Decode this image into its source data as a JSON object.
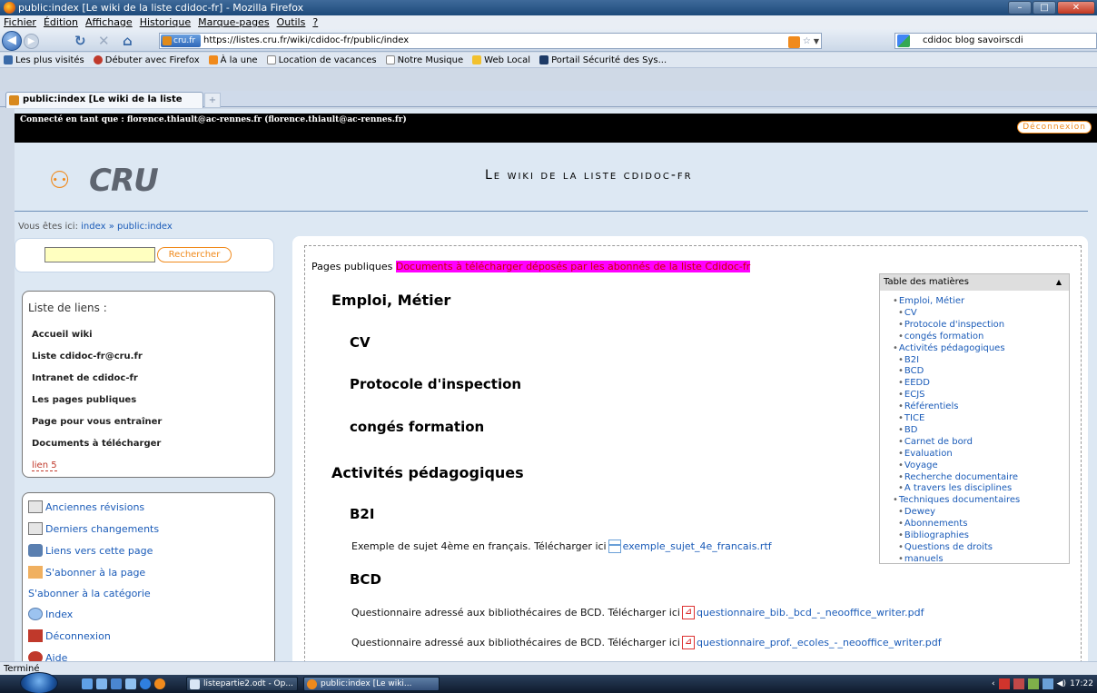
{
  "window": {
    "title": "public:index [Le wiki de la liste cdidoc-fr] - Mozilla Firefox"
  },
  "menu": [
    "Fichier",
    "Édition",
    "Affichage",
    "Historique",
    "Marque-pages",
    "Outils",
    "?"
  ],
  "nav": {
    "url": "https://listes.cru.fr/wiki/cdidoc-fr/public/index",
    "site_badge": "cru.fr",
    "search_value": "cdidoc blog savoirscdi"
  },
  "bookmarks": [
    {
      "label": "Les plus visités"
    },
    {
      "label": "Débuter avec Firefox"
    },
    {
      "label": "À la une"
    },
    {
      "label": "Location de vacances"
    },
    {
      "label": "Notre Musique"
    },
    {
      "label": "Web Local"
    },
    {
      "label": "Portail Sécurité des Sys..."
    }
  ],
  "tab": {
    "label": "public:index [Le wiki de la liste cdidoc...",
    "close": "+"
  },
  "page": {
    "user_label": "Connecté en tant que : florence.thiault@ac-rennes.fr (florence.thiault@ac-rennes.fr)",
    "logout": "Déconnexion",
    "logo_text": "CRU",
    "site_title": "Le wiki de la liste cdidoc-fr",
    "crumb_prefix": "Vous êtes ici:",
    "crumb_1": "index",
    "crumb_sep": "»",
    "crumb_2": "public:index",
    "search_button": "Rechercher",
    "links_title": "Liste de liens :",
    "links": [
      "Accueil wiki",
      "Liste cdidoc-fr@cru.fr",
      "Intranet de cdidoc-fr",
      "Les pages publiques",
      "Page pour vous entraîner",
      "Documents à télécharger",
      "lien 5"
    ],
    "tools": [
      "Anciennes révisions",
      "Derniers changements",
      "Liens vers cette page",
      "S'abonner à la page",
      "S'abonner à la catégorie",
      "Index",
      "Déconnexion",
      "Aide"
    ]
  },
  "content": {
    "path_label": "Pages publiques",
    "highlight": "Documents à télécharger déposés par les abonnés de la liste Cdidoc-fr",
    "h_emploi": "Emploi, Métier",
    "h_cv": "CV",
    "h_protocole": "Protocole d'inspection",
    "h_conges": "congés formation",
    "h_activites": "Activités pédagogiques",
    "h_b2i": "B2I",
    "b2i_text": "Exemple de sujet 4ème en français. Télécharger ici",
    "b2i_file": "exemple_sujet_4e_francais.rtf",
    "h_bcd": "BCD",
    "bcd_text_1": "Questionnaire adressé aux bibliothécaires de BCD. Télécharger ici",
    "bcd_file_1": "questionnaire_bib._bcd_-_neooffice_writer.pdf",
    "bcd_text_2": "Questionnaire adressé aux bibliothécaires de BCD. Télécharger ici",
    "bcd_file_2": "questionnaire_prof._ecoles_-_neooffice_writer.pdf"
  },
  "toc": {
    "title": "Table des matières",
    "items": [
      {
        "label": "Emploi, Métier",
        "level": 1
      },
      {
        "label": "CV",
        "level": 2
      },
      {
        "label": "Protocole d'inspection",
        "level": 2
      },
      {
        "label": "congés formation",
        "level": 2
      },
      {
        "label": "Activités pédagogiques",
        "level": 1
      },
      {
        "label": "B2I",
        "level": 2
      },
      {
        "label": "BCD",
        "level": 2
      },
      {
        "label": "EEDD",
        "level": 2
      },
      {
        "label": "ECJS",
        "level": 2
      },
      {
        "label": "Référentiels",
        "level": 2
      },
      {
        "label": "TICE",
        "level": 2
      },
      {
        "label": "BD",
        "level": 2
      },
      {
        "label": "Carnet de bord",
        "level": 2
      },
      {
        "label": "Evaluation",
        "level": 2
      },
      {
        "label": "Voyage",
        "level": 2
      },
      {
        "label": "Recherche documentaire",
        "level": 2
      },
      {
        "label": "A travers les disciplines",
        "level": 2
      },
      {
        "label": "Techniques documentaires",
        "level": 1
      },
      {
        "label": "Dewey",
        "level": 2
      },
      {
        "label": "Abonnements",
        "level": 2
      },
      {
        "label": "Bibliographies",
        "level": 2
      },
      {
        "label": "Questions de droits",
        "level": 2
      },
      {
        "label": "manuels",
        "level": 2
      }
    ]
  },
  "status": "Terminé",
  "taskbar": {
    "task_1": "listepartie2.odt - Op...",
    "task_2": "public:index [Le wiki...",
    "clock": "17:22"
  },
  "colors": {
    "highlight": "#ff00ff",
    "accent": "#f08a1c",
    "link": "#1a5bb8"
  }
}
